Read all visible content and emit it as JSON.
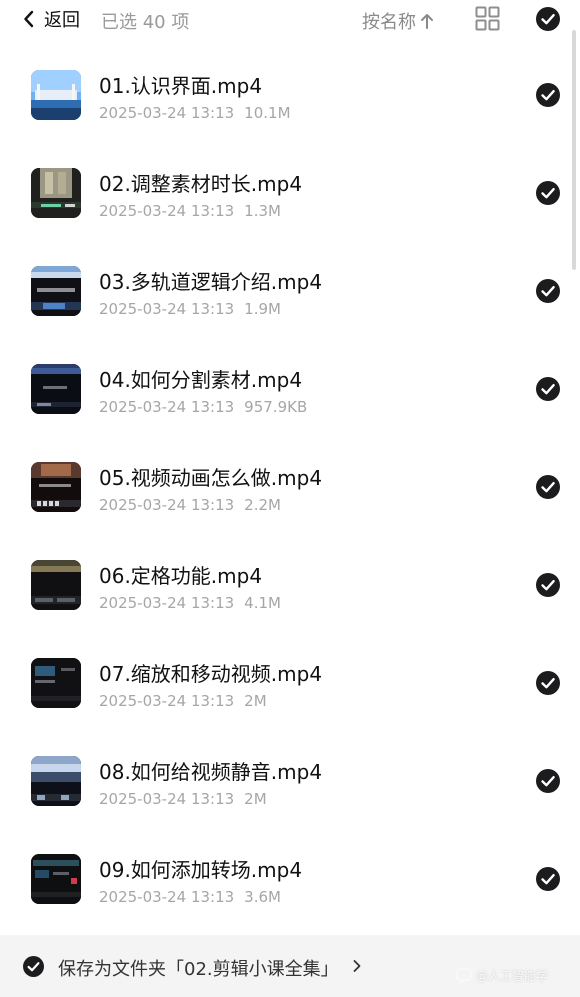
{
  "header": {
    "back_label": "返回",
    "selected_count": "已选 40 项",
    "sort_label": "按名称"
  },
  "files": [
    {
      "name": "01.认识界面.mp4",
      "date": "2025-03-24 13:13",
      "size": "10.1M",
      "selected": true
    },
    {
      "name": "02.调整素材时长.mp4",
      "date": "2025-03-24 13:13",
      "size": "1.3M",
      "selected": true
    },
    {
      "name": "03.多轨道逻辑介绍.mp4",
      "date": "2025-03-24 13:13",
      "size": "1.9M",
      "selected": true
    },
    {
      "name": "04.如何分割素材.mp4",
      "date": "2025-03-24 13:13",
      "size": "957.9KB",
      "selected": true
    },
    {
      "name": "05.视频动画怎么做.mp4",
      "date": "2025-03-24 13:13",
      "size": "2.2M",
      "selected": true
    },
    {
      "name": "06.定格功能.mp4",
      "date": "2025-03-24 13:13",
      "size": "4.1M",
      "selected": true
    },
    {
      "name": "07.缩放和移动视频.mp4",
      "date": "2025-03-24 13:13",
      "size": "2M",
      "selected": true
    },
    {
      "name": "08.如何给视频静音.mp4",
      "date": "2025-03-24 13:13",
      "size": "2M",
      "selected": true
    },
    {
      "name": "09.如何添加转场.mp4",
      "date": "2025-03-24 13:13",
      "size": "3.6M",
      "selected": true
    }
  ],
  "footer": {
    "save_text": "保存为文件夹「02.剪辑小课全集」",
    "save_enabled": true
  },
  "watermark": {
    "text": "@人工智能学"
  },
  "icons": {
    "back": "chevron-left-icon",
    "sort": "arrow-up-icon",
    "view": "grid-view-icon",
    "check": "checkmark-circle-icon",
    "footer_chevron": "chevron-right-icon"
  },
  "colors": {
    "check_fill": "#1c1c1e",
    "secondary_text": "#a6a6a6",
    "footer_bg": "#f4f4f4"
  }
}
